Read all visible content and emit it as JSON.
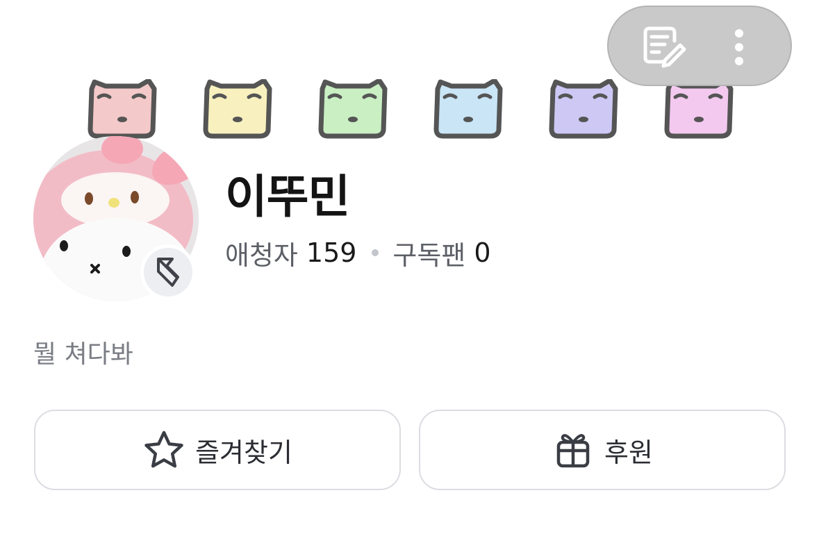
{
  "header": {
    "edit_icon": "note-edit-icon",
    "more_icon": "vertical-ellipsis-icon"
  },
  "banner": {
    "faces": [
      {
        "color": "#f4c9c9"
      },
      {
        "color": "#f8f1bf"
      },
      {
        "color": "#c9efc3"
      },
      {
        "color": "#c9e5f6"
      },
      {
        "color": "#cdc8f4"
      },
      {
        "color": "#f3c9ef"
      }
    ]
  },
  "profile": {
    "name": "이뚜민",
    "fans_label": "애청자",
    "fans_count": "159",
    "subs_label": "구독팬",
    "subs_count": "0",
    "bio": "뭘 쳐다봐",
    "badge_icon": "platform-badge-icon"
  },
  "actions": {
    "favorite_label": "즐겨찾기",
    "favorite_icon": "star-icon",
    "sponsor_label": "후원",
    "sponsor_icon": "gift-icon"
  },
  "colors": {
    "pill_bg": "#c9c9c9",
    "button_border": "#dcdde2",
    "text_secondary": "#5c5f66"
  }
}
